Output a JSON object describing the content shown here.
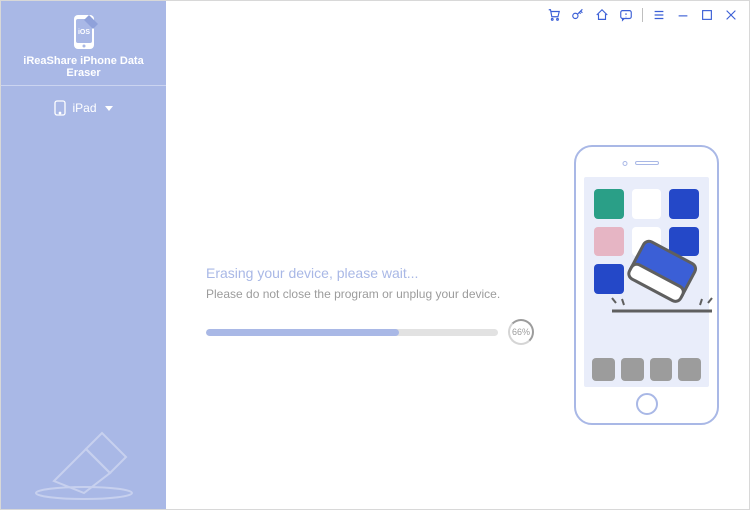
{
  "brand": {
    "name": "iReaShare iPhone Data Eraser"
  },
  "sidebar": {
    "device_label": "iPad"
  },
  "titlebar": {
    "icons": [
      "cart",
      "key",
      "home",
      "feedback",
      "menu",
      "minimize",
      "maximize",
      "close"
    ]
  },
  "erase": {
    "heading": "Erasing your device, please wait...",
    "subtext": "Please do not close the program or unplug your device.",
    "percent_label": "66%",
    "percent_value": 66
  },
  "phone": {
    "row1": [
      "teal",
      "white",
      "blue"
    ],
    "row2": [
      "pink",
      "white",
      "blue"
    ],
    "row3": [
      "blue"
    ],
    "dock_count": 4
  }
}
